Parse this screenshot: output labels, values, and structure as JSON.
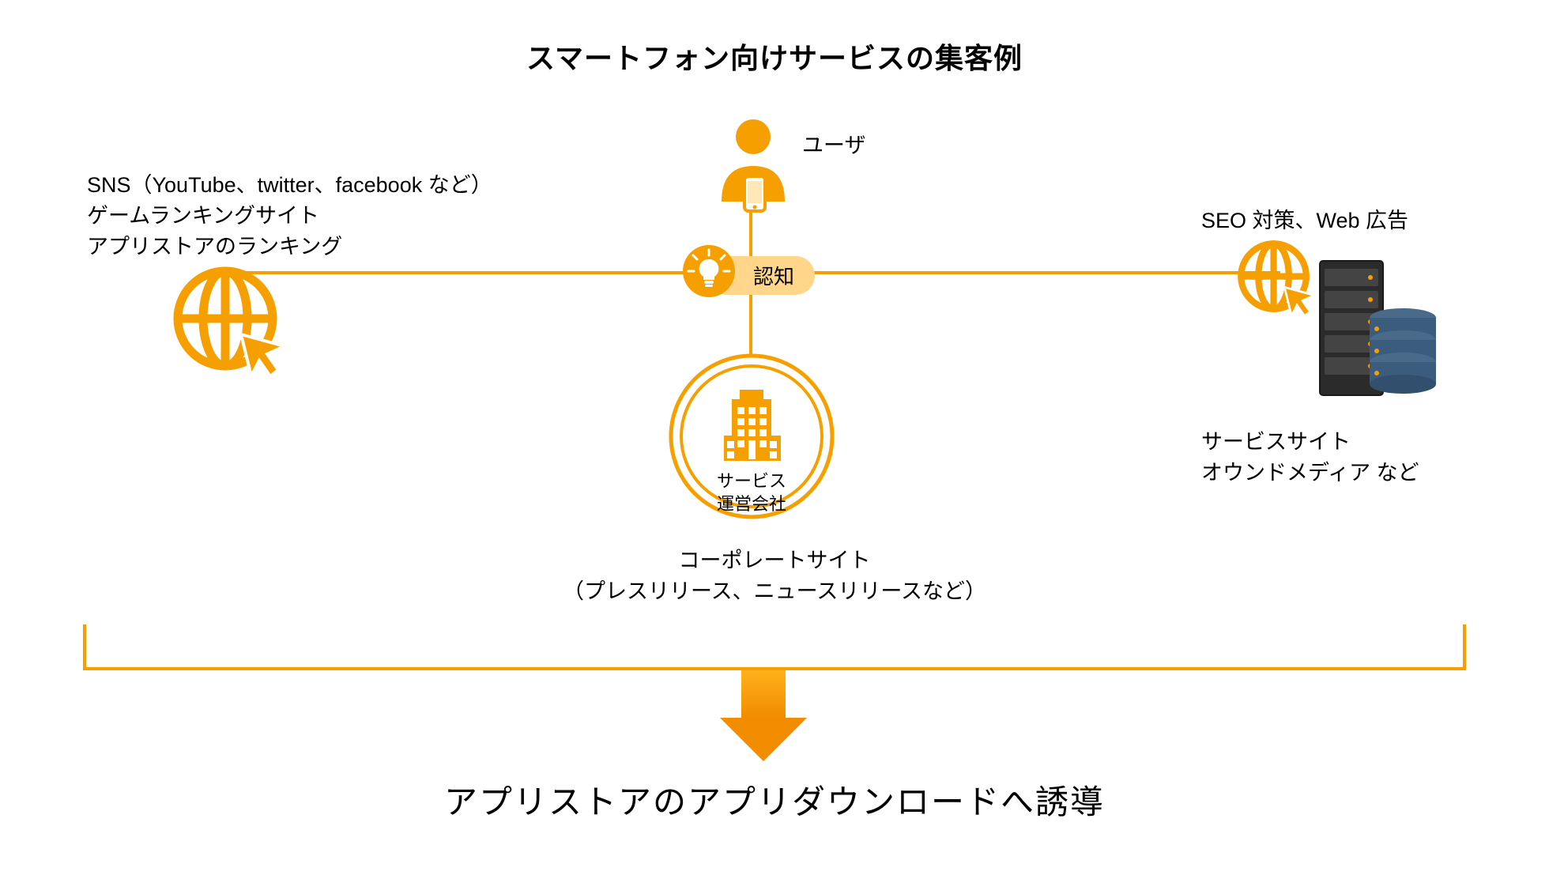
{
  "title": "スマートフォン向けサービスの集客例",
  "user_label": "ユーザ",
  "awareness_label": "認知",
  "left": {
    "line1": "SNS（YouTube、twitter、facebook など）",
    "line2": "ゲームランキングサイト",
    "line3": "アプリストアのランキング"
  },
  "right": {
    "line1": "SEO 対策、Web 広告",
    "caption1": "サービスサイト",
    "caption2": "オウンドメディア など"
  },
  "center": {
    "company_line1": "サービス",
    "company_line2": "運営会社",
    "corp_line1": "コーポレートサイト",
    "corp_line2": "（プレスリリース、ニュースリリースなど）"
  },
  "bottom": "アプリストアのアプリダウンロードへ誘導",
  "colors": {
    "accent": "#f5a000",
    "accent_light": "#ffd68a",
    "dark": "#2b2b2b"
  }
}
